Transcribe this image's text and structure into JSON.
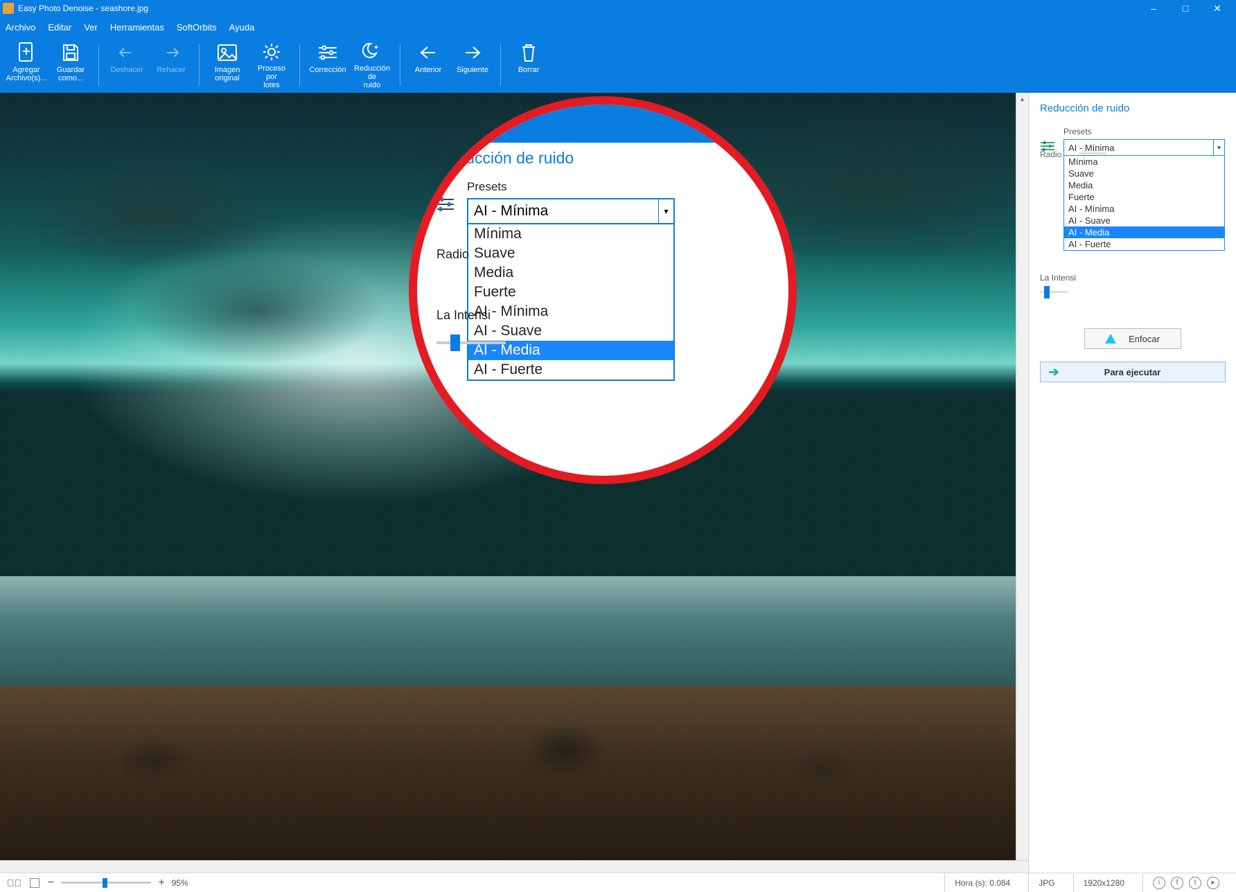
{
  "window": {
    "title": "Easy Photo Denoise - seashore.jpg"
  },
  "menus": [
    "Archivo",
    "Editar",
    "Ver",
    "Herramientas",
    "SoftOrbits",
    "Ayuda"
  ],
  "toolbar": {
    "add": "Agregar\nArchivo(s)...",
    "saveas": "Guardar\ncomo...",
    "undo": "Deshacer",
    "redo": "Rehacer",
    "original": "Imagen\noriginal",
    "batch": "Proceso\npor\nlotes",
    "correction": "Corrección",
    "denoise": "Reducción\nde\nruido",
    "prev": "Anterior",
    "next": "Siguiente",
    "delete": "Borrar"
  },
  "panel": {
    "title": "Reducción de ruido",
    "presets_label": "Presets",
    "selected": "AI - Mínima",
    "options": [
      "Mínima",
      "Suave",
      "Media",
      "Fuerte",
      "AI - Mínima",
      "AI - Suave",
      "AI - Media",
      "AI - Fuerte"
    ],
    "highlight": "AI - Media",
    "radio_label": "Radio",
    "intensity_label": "La Intensi",
    "intensity_label_full": "La Intensi",
    "enfocar": "Enfocar",
    "run": "Para ejecutar"
  },
  "zoom_panel": {
    "title": "Reducción de ruido",
    "presets_label": "Presets",
    "selected": "AI - Mínima",
    "radio_label": "Radio",
    "intensity_label": "La Intensi"
  },
  "status": {
    "zoom_pct": "95%",
    "time": "Hora (s): 0.084",
    "format": "JPG",
    "dims": "1920x1280"
  }
}
